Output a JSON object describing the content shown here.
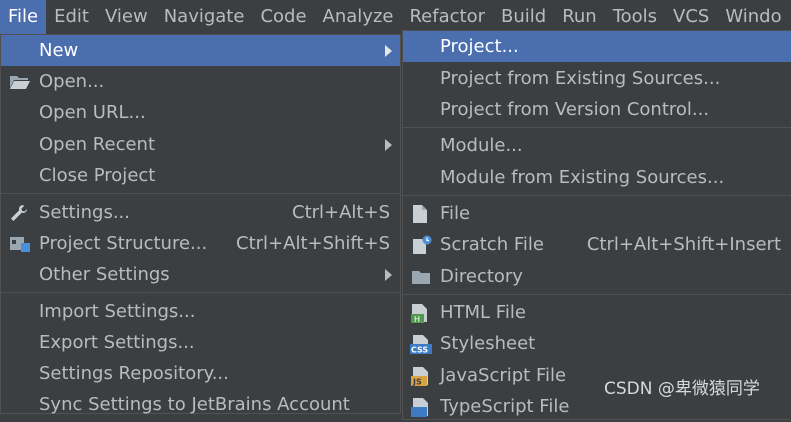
{
  "menubar": {
    "items": [
      "File",
      "Edit",
      "View",
      "Navigate",
      "Code",
      "Analyze",
      "Refactor",
      "Build",
      "Run",
      "Tools",
      "VCS",
      "Windo"
    ]
  },
  "file_menu": {
    "new": "New",
    "open": "Open...",
    "open_url": "Open URL...",
    "open_recent": "Open Recent",
    "close_project": "Close Project",
    "settings": "Settings...",
    "settings_shortcut": "Ctrl+Alt+S",
    "project_structure": "Project Structure...",
    "project_structure_shortcut": "Ctrl+Alt+Shift+S",
    "other_settings": "Other Settings",
    "import_settings": "Import Settings...",
    "export_settings": "Export Settings...",
    "settings_repository": "Settings Repository...",
    "sync_settings": "Sync Settings to JetBrains Account"
  },
  "new_submenu": {
    "project": "Project...",
    "project_existing": "Project from Existing Sources...",
    "project_vcs": "Project from Version Control...",
    "module": "Module...",
    "module_existing": "Module from Existing Sources...",
    "file": "File",
    "scratch_file": "Scratch File",
    "scratch_file_shortcut": "Ctrl+Alt+Shift+Insert",
    "directory": "Directory",
    "html_file": "HTML File",
    "stylesheet": "Stylesheet",
    "javascript_file": "JavaScript File",
    "typescript_file": "TypeScript File"
  },
  "icon_badges": {
    "html": "H",
    "css": "CSS",
    "js": "JS"
  },
  "watermark": "CSDN @卑微猿同学",
  "colors": {
    "background": "#3c3f41",
    "highlight": "#4b6eaf",
    "text": "#bbbbbb",
    "separator": "#515151"
  }
}
